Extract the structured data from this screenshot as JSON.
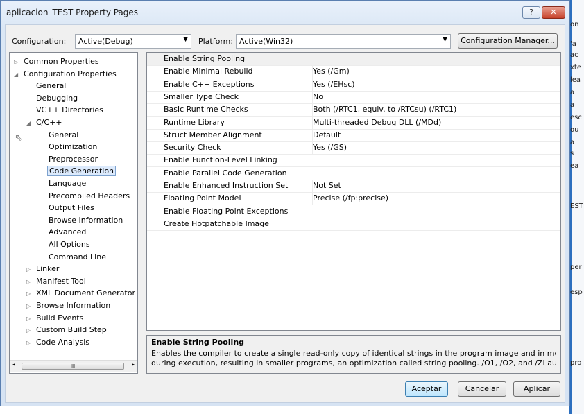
{
  "window": {
    "title": "aplicacion_TEST Property Pages",
    "help_label": "?",
    "close_label": "✕"
  },
  "top_bar": {
    "configuration_label": "Configuration:",
    "configuration_value": "Active(Debug)",
    "platform_label": "Platform:",
    "platform_value": "Active(Win32)",
    "config_manager_label": "Configuration Manager..."
  },
  "tree": [
    {
      "label": "Common Properties",
      "toggle": "▷",
      "indent": 0
    },
    {
      "label": "Configuration Properties",
      "toggle": "◢",
      "indent": 0
    },
    {
      "label": "General",
      "toggle": "",
      "indent": 1
    },
    {
      "label": "Debugging",
      "toggle": "",
      "indent": 1
    },
    {
      "label": "VC++ Directories",
      "toggle": "",
      "indent": 1
    },
    {
      "label": "C/C++",
      "toggle": "◢",
      "indent": 1
    },
    {
      "label": "General",
      "toggle": "",
      "indent": 2
    },
    {
      "label": "Optimization",
      "toggle": "",
      "indent": 2
    },
    {
      "label": "Preprocessor",
      "toggle": "",
      "indent": 2
    },
    {
      "label": "Code Generation",
      "toggle": "",
      "indent": 2,
      "selected": true
    },
    {
      "label": "Language",
      "toggle": "",
      "indent": 2
    },
    {
      "label": "Precompiled Headers",
      "toggle": "",
      "indent": 2
    },
    {
      "label": "Output Files",
      "toggle": "",
      "indent": 2
    },
    {
      "label": "Browse Information",
      "toggle": "",
      "indent": 2
    },
    {
      "label": "Advanced",
      "toggle": "",
      "indent": 2
    },
    {
      "label": "All Options",
      "toggle": "",
      "indent": 2
    },
    {
      "label": "Command Line",
      "toggle": "",
      "indent": 2
    },
    {
      "label": "Linker",
      "toggle": "▷",
      "indent": 1
    },
    {
      "label": "Manifest Tool",
      "toggle": "▷",
      "indent": 1
    },
    {
      "label": "XML Document Generator",
      "toggle": "▷",
      "indent": 1
    },
    {
      "label": "Browse Information",
      "toggle": "▷",
      "indent": 1
    },
    {
      "label": "Build Events",
      "toggle": "▷",
      "indent": 1
    },
    {
      "label": "Custom Build Step",
      "toggle": "▷",
      "indent": 1
    },
    {
      "label": "Code Analysis",
      "toggle": "▷",
      "indent": 1
    }
  ],
  "tree_scroll": {
    "left": "◂",
    "right": "▸",
    "thumb": "III"
  },
  "properties": [
    {
      "name": "Enable String Pooling",
      "value": ""
    },
    {
      "name": "Enable Minimal Rebuild",
      "value": "Yes (/Gm)"
    },
    {
      "name": "Enable C++ Exceptions",
      "value": "Yes (/EHsc)"
    },
    {
      "name": "Smaller Type Check",
      "value": "No"
    },
    {
      "name": "Basic Runtime Checks",
      "value": "Both (/RTC1, equiv. to /RTCsu) (/RTC1)"
    },
    {
      "name": "Runtime Library",
      "value": "Multi-threaded Debug DLL (/MDd)"
    },
    {
      "name": "Struct Member Alignment",
      "value": "Default"
    },
    {
      "name": "Security Check",
      "value": "Yes (/GS)"
    },
    {
      "name": "Enable Function-Level Linking",
      "value": ""
    },
    {
      "name": "Enable Parallel Code Generation",
      "value": ""
    },
    {
      "name": "Enable Enhanced Instruction Set",
      "value": "Not Set"
    },
    {
      "name": "Floating Point Model",
      "value": "Precise (/fp:precise)"
    },
    {
      "name": "Enable Floating Point Exceptions",
      "value": ""
    },
    {
      "name": "Create Hotpatchable Image",
      "value": ""
    }
  ],
  "description": {
    "title": "Enable String Pooling",
    "line1": "Enables the compiler to create a single read-only copy of identical strings in the program image and in memory",
    "line2": "during execution, resulting in smaller programs, an optimization called string pooling. /O1, /O2, and /ZI automat..."
  },
  "buttons": {
    "accept": "Aceptar",
    "cancel": "Cancelar",
    "apply": "Aplicar"
  },
  "background_strip": [
    "on",
    "'a",
    "ac",
    "xte",
    "lea",
    "a",
    "a",
    "esc",
    "ou",
    "a",
    "s",
    "ea",
    "EST",
    "per",
    "esp",
    "pro"
  ]
}
